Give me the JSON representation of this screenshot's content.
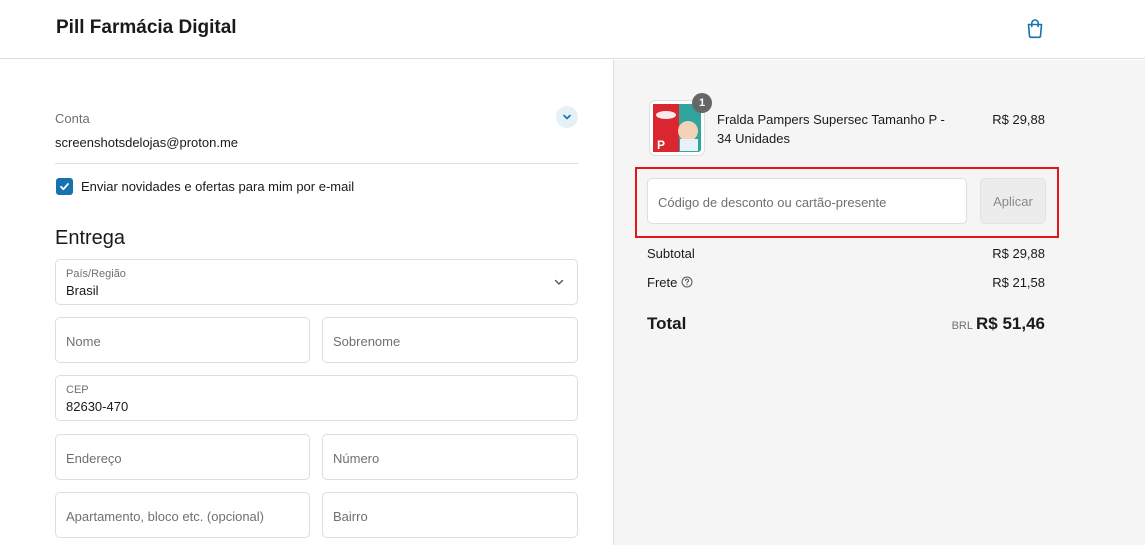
{
  "header": {
    "store_name": "Pill Farmácia Digital",
    "cart_icon": "shopping-bag-icon"
  },
  "account": {
    "label": "Conta",
    "email": "screenshotsdelojas@proton.me",
    "toggle_icon": "chevron-down-icon"
  },
  "newsletter": {
    "checked": true,
    "label": "Enviar novidades e ofertas para mim por e-mail"
  },
  "delivery": {
    "title": "Entrega",
    "country": {
      "label": "País/Região",
      "value": "Brasil"
    },
    "first_name": {
      "placeholder": "Nome"
    },
    "last_name": {
      "placeholder": "Sobrenome"
    },
    "cep": {
      "label": "CEP",
      "value": "82630-470"
    },
    "address": {
      "placeholder": "Endereço"
    },
    "number": {
      "placeholder": "Número"
    },
    "apartment": {
      "placeholder": "Apartamento, bloco etc. (opcional)"
    },
    "neighborhood": {
      "placeholder": "Bairro"
    }
  },
  "summary": {
    "product": {
      "quantity": "1",
      "name": "Fralda Pampers Supersec Tamanho P - 34 Unidades",
      "price": "R$ 29,88"
    },
    "discount": {
      "placeholder": "Código de desconto ou cartão-presente",
      "button_label": "Aplicar"
    },
    "subtotal": {
      "label": "Subtotal",
      "value": "R$ 29,88"
    },
    "shipping": {
      "label": "Frete",
      "value": "R$ 21,58",
      "help_icon": "question-circle-icon"
    },
    "total": {
      "label": "Total",
      "currency": "BRL",
      "value": "R$ 51,46"
    }
  },
  "colors": {
    "accent": "#1773b0",
    "highlight": "#e4141b",
    "summary_bg": "#f5f5f5"
  }
}
